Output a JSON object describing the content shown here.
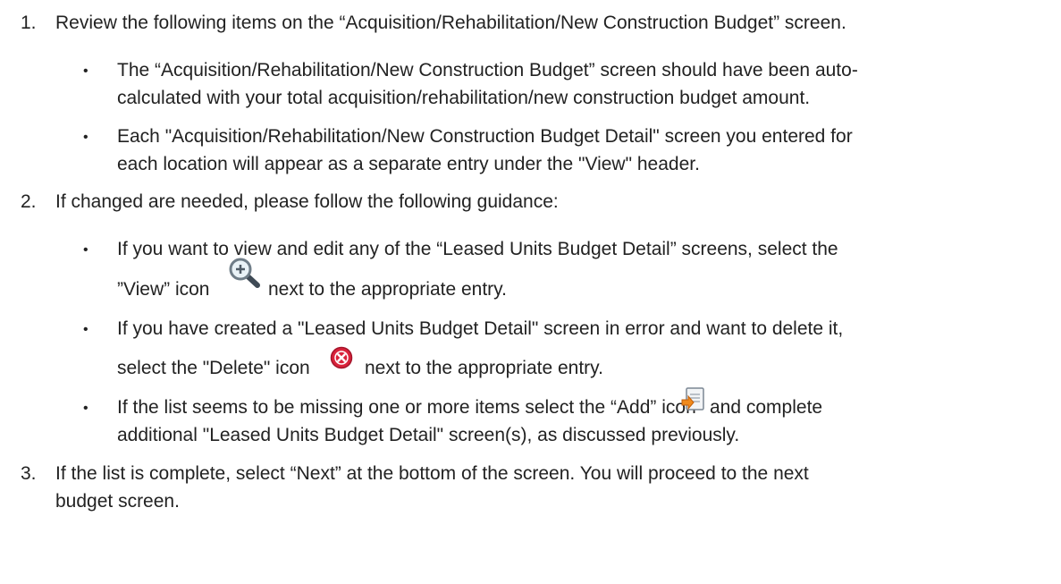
{
  "steps": [
    {
      "number": "1.",
      "text": "Review the following items on the “Acquisition/Rehabilitation/New Construction Budget” screen.",
      "bullets": [
        {
          "line1": "The “Acquisition/Rehabilitation/New Construction Budget” screen should have been auto-",
          "line2": "calculated with your total acquisition/rehabilitation/new construction budget amount."
        },
        {
          "line1": "Each \"Acquisition/Rehabilitation/New Construction Budget Detail\" screen you entered for",
          "line2": "each location will appear as a separate entry under the \"View\" header."
        }
      ]
    },
    {
      "number": "2.",
      "text": "If changed are needed, please follow the following guidance:",
      "bullets": [
        {
          "line1": "If you want to view and edit any of the “Leased Units Budget Detail” screens, select the",
          "line2_before": "”View” icon",
          "line2_after": "next to the appropriate entry.",
          "icon": "view-magnifier-plus-icon"
        },
        {
          "line1": "If you have created a \"Leased Units Budget Detail\" screen in error and want to delete it,",
          "line2_before": "select the \"Delete\" icon",
          "line2_after": "next to the appropriate entry.",
          "icon": "delete-red-x-icon"
        },
        {
          "line1_before": "If the list seems to be missing one or more items select the “Add” icon",
          "line1_after": "and complete",
          "line2": "additional \"Leased Units Budget Detail\" screen(s), as discussed previously.",
          "icon": "add-document-icon"
        }
      ]
    },
    {
      "number": "3.",
      "line1": "If the list is complete, select “Next” at the bottom of the screen. You will proceed to the next",
      "line2": "budget screen."
    }
  ],
  "bullet_glyph": "•"
}
